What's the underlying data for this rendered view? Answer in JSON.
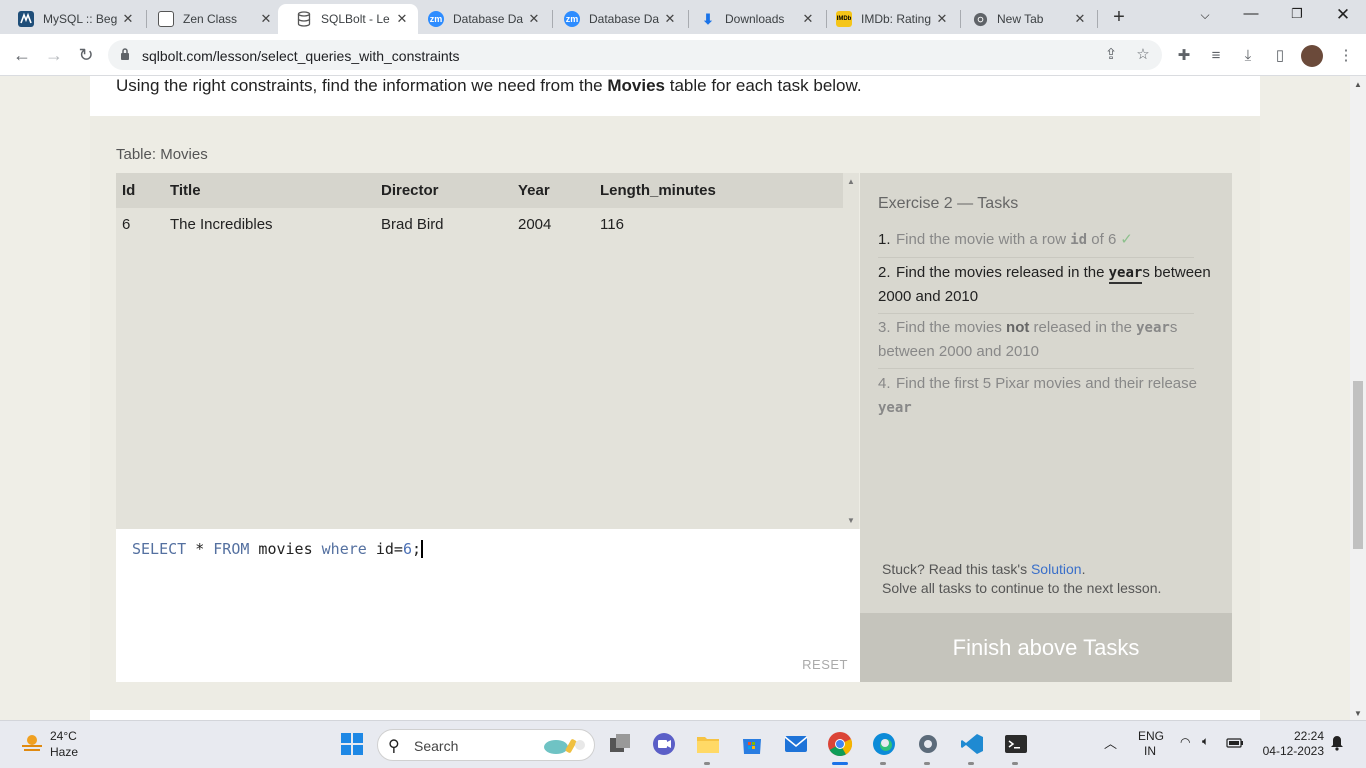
{
  "browser": {
    "tabs": [
      {
        "title": "MySQL :: Beg",
        "icon": "mysql-icon"
      },
      {
        "title": "Zen Class",
        "icon": "zen-class-icon"
      },
      {
        "title": "SQLBolt - Le",
        "icon": "database-icon",
        "active": true
      },
      {
        "title": "Database Da",
        "icon": "zoom-icon"
      },
      {
        "title": "Database Da",
        "icon": "zoom-icon"
      },
      {
        "title": "Downloads",
        "icon": "download-icon"
      },
      {
        "title": "IMDb: Rating",
        "icon": "imdb-icon"
      },
      {
        "title": "New Tab",
        "icon": "chrome-icon"
      }
    ],
    "url": "sqlbolt.com/lesson/select_queries_with_constraints",
    "colors": {
      "zoom": "#2d8cff",
      "imdb": "#f5c518",
      "download": "#1a73e8"
    }
  },
  "lesson": {
    "intro_prefix": "Using the right constraints, find the information we need from the ",
    "intro_bold": "Movies",
    "intro_suffix": " table for each task below."
  },
  "table": {
    "label": "Table: Movies",
    "columns": [
      "Id",
      "Title",
      "Director",
      "Year",
      "Length_minutes"
    ],
    "rows": [
      [
        "6",
        "The Incredibles",
        "Brad Bird",
        "2004",
        "116"
      ]
    ]
  },
  "editor": {
    "kw_select": "SELECT",
    "star": " * ",
    "kw_from": "FROM",
    "table": " movies ",
    "kw_where": "where",
    "cond": " id=",
    "value": "6",
    "end": ";",
    "reset_label": "RESET"
  },
  "tasks": {
    "title": "Exercise 2 — Tasks",
    "items": [
      {
        "num": "1.",
        "a": "Find the movie with a row ",
        "code": "id",
        "b": " of 6",
        "check": "✓",
        "state": "done"
      },
      {
        "num": "2.",
        "a": "Find the movies released in the ",
        "code": "year",
        "b": "s between 2000 and 2010",
        "state": "current"
      },
      {
        "num": "3.",
        "a": "Find the movies ",
        "bold": "not",
        "a2": " released in the ",
        "code": "year",
        "b": "s between 2000 and 2010",
        "state": "pending"
      },
      {
        "num": "4.",
        "a": "Find the first 5 Pixar movies and their release ",
        "code": "year",
        "state": "pending"
      }
    ],
    "stuck_prefix": "Stuck? Read this task's ",
    "solution_link": "Solution",
    "stuck_suffix": ".",
    "solve_all": "Solve all tasks to continue to the next lesson.",
    "finish_label": "Finish above Tasks"
  },
  "taskbar": {
    "temperature": "24°C",
    "condition": "Haze",
    "search_label": "Search",
    "lang_top": "ENG",
    "lang_bottom": "IN",
    "time": "22:24",
    "date": "04-12-2023"
  }
}
